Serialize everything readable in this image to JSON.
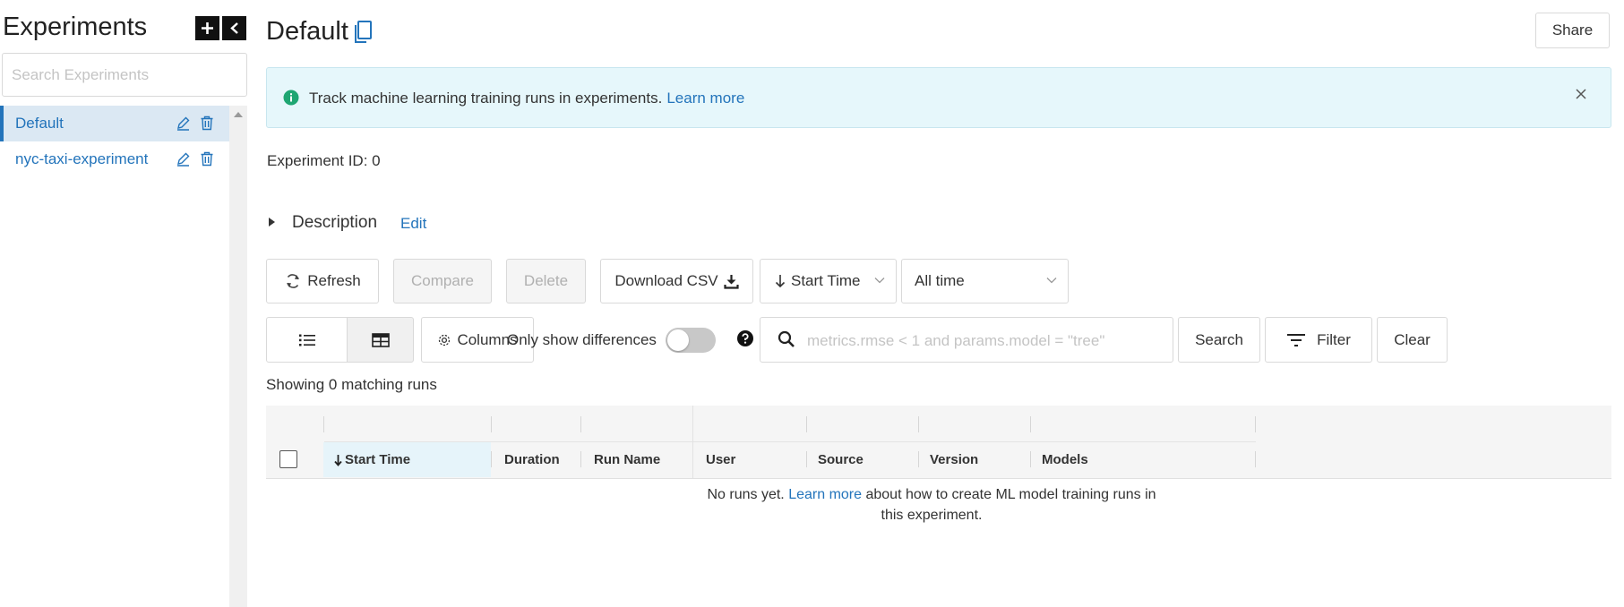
{
  "sidebar": {
    "title": "Experiments",
    "add_symbol": "+",
    "collapse_symbol": "<",
    "search_placeholder": "Search Experiments",
    "experiments": [
      {
        "label": "Default",
        "active": true
      },
      {
        "label": "nyc-taxi-experiment",
        "active": false
      }
    ]
  },
  "header": {
    "title": "Default",
    "share_label": "Share"
  },
  "banner": {
    "text": "Track machine learning training runs in experiments.",
    "link": "Learn more",
    "close": "×"
  },
  "experiment_id": "Experiment ID:  0",
  "description": {
    "label": "Description",
    "edit": "Edit"
  },
  "toolbar": {
    "refresh": "Refresh",
    "compare": "Compare",
    "delete": "Delete",
    "download": "Download CSV",
    "sort": "Start Time",
    "time_range": "All time",
    "columns": "Columns",
    "only_diff": "Only show differences",
    "search_placeholder": "metrics.rmse < 1 and params.model = \"tree\"",
    "search": "Search",
    "filter": "Filter",
    "clear": "Clear"
  },
  "showing": "Showing 0 matching runs",
  "table": {
    "columns": [
      "Start Time",
      "Duration",
      "Run Name",
      "User",
      "Source",
      "Version",
      "Models"
    ],
    "empty_before": "No runs yet.",
    "empty_link": "Learn more",
    "empty_after": "about how to create ML model training runs in this experiment."
  },
  "colors": {
    "accent": "#2374bb",
    "banner_bg": "#e6f7fb",
    "info_icon": "#1ea672"
  }
}
